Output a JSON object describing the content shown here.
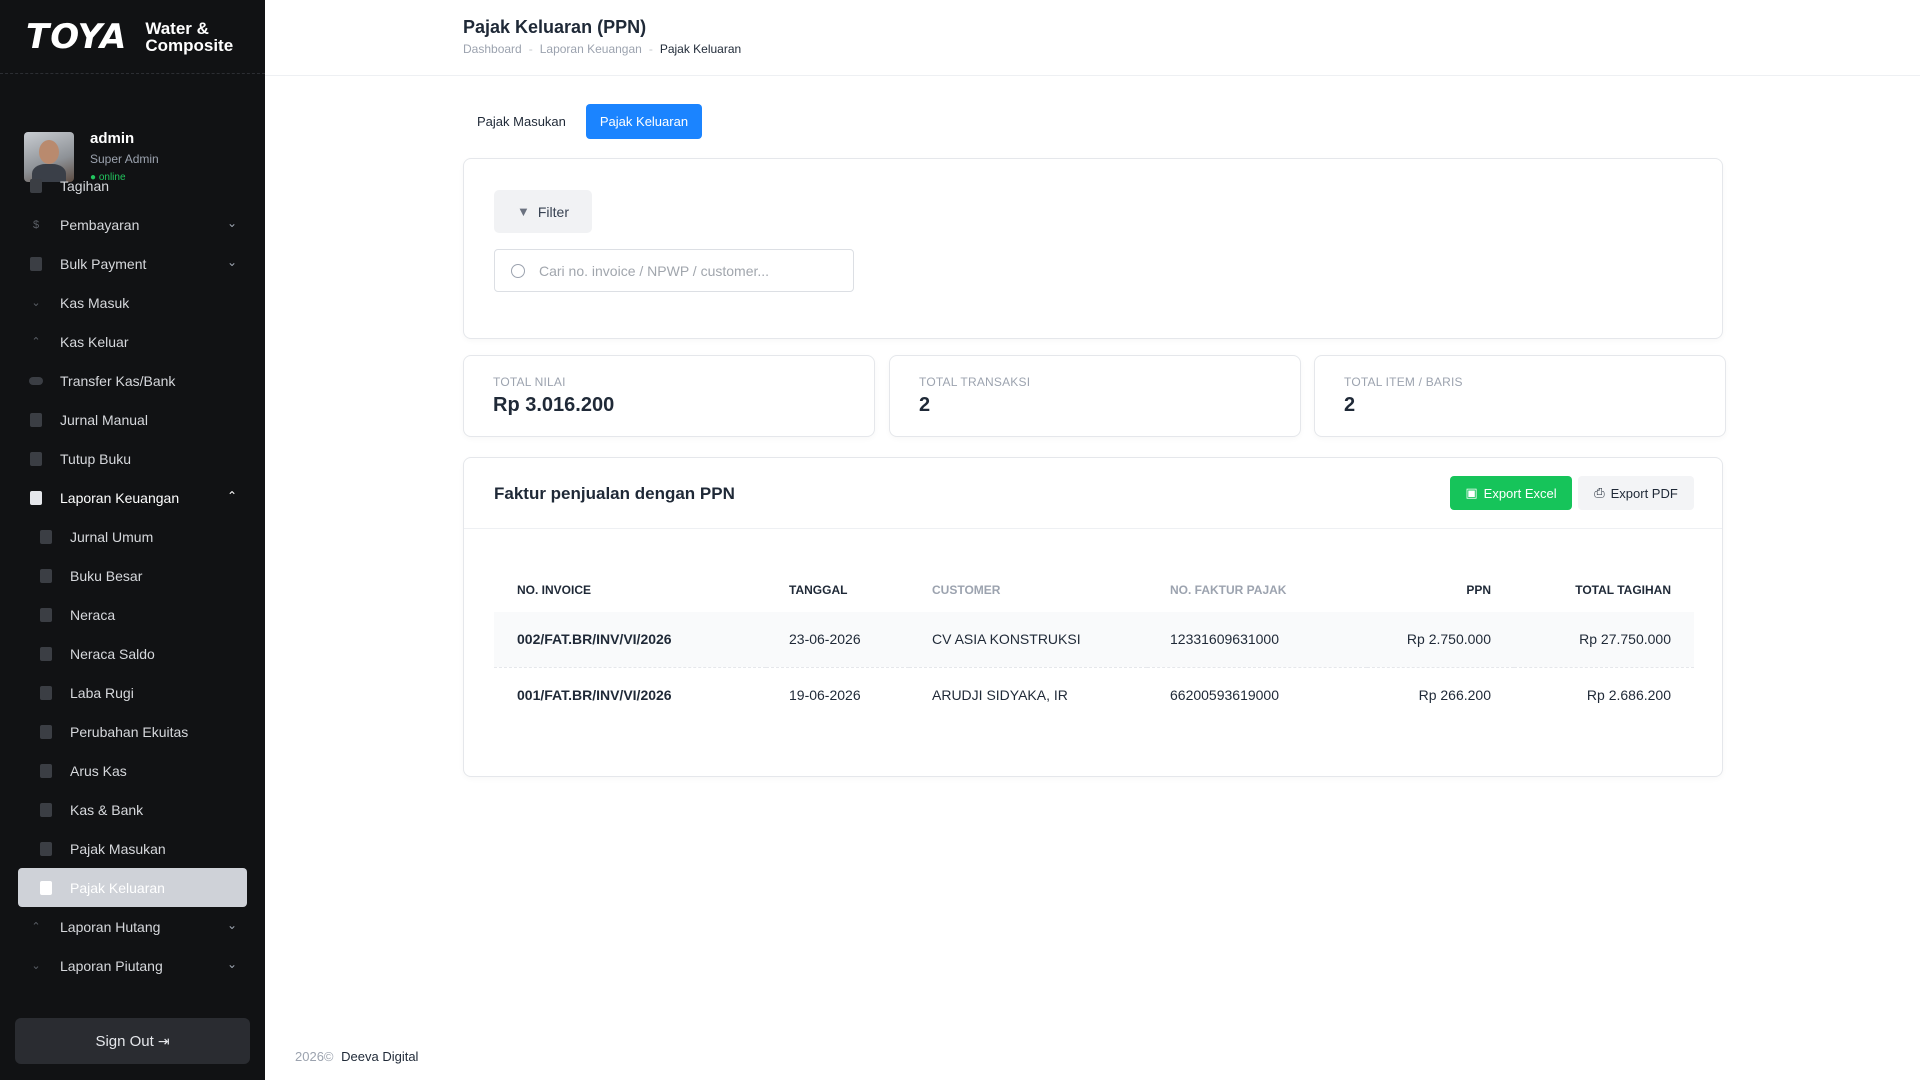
{
  "brand": {
    "logo": "TOYA",
    "sub_line1": "Water &",
    "sub_line2": "Composite"
  },
  "user": {
    "name": "admin",
    "role": "Super Admin",
    "status": "● online"
  },
  "sidebar": {
    "items": [
      {
        "label": "Tagihan"
      },
      {
        "label": "Pembayaran"
      },
      {
        "label": "Bulk Payment"
      },
      {
        "label": "Kas Masuk"
      },
      {
        "label": "Kas Keluar"
      },
      {
        "label": "Transfer Kas/Bank"
      },
      {
        "label": "Jurnal Manual"
      },
      {
        "label": "Tutup Buku"
      },
      {
        "label": "Laporan Keuangan"
      },
      {
        "label": "Jurnal Umum"
      },
      {
        "label": "Buku Besar"
      },
      {
        "label": "Neraca"
      },
      {
        "label": "Neraca Saldo"
      },
      {
        "label": "Laba Rugi"
      },
      {
        "label": "Perubahan Ekuitas"
      },
      {
        "label": "Arus Kas"
      },
      {
        "label": "Kas & Bank"
      },
      {
        "label": "Pajak Masukan"
      },
      {
        "label": "Pajak Keluaran"
      },
      {
        "label": "Laporan Hutang"
      },
      {
        "label": "Laporan Piutang"
      }
    ],
    "signout_label": "Sign Out"
  },
  "header": {
    "title": "Pajak Keluaran (PPN)",
    "breadcrumb": [
      "Dashboard",
      "Laporan Keuangan",
      "Pajak Keluaran"
    ]
  },
  "tabs": [
    {
      "label": "Pajak Masukan",
      "active": false
    },
    {
      "label": "Pajak Keluaran",
      "active": true
    }
  ],
  "filter": {
    "button_label": "Filter",
    "search_placeholder": "Cari no. invoice / NPWP / customer...",
    "search_value": ""
  },
  "stats": [
    {
      "label": "TOTAL NILAI",
      "value": "Rp 3.016.200"
    },
    {
      "label": "TOTAL TRANSAKSI",
      "value": "2"
    },
    {
      "label": "TOTAL ITEM / BARIS",
      "value": "2"
    }
  ],
  "table": {
    "title": "Faktur penjualan dengan PPN",
    "export_excel_label": "Export Excel",
    "export_pdf_label": "Export PDF",
    "columns": [
      "NO. INVOICE",
      "TANGGAL",
      "CUSTOMER",
      "NO. FAKTUR PAJAK",
      "PPN",
      "TOTAL TAGIHAN"
    ],
    "rows": [
      [
        "002/FAT.BR/INV/VI/2026",
        "23-06-2026",
        "CV ASIA KONSTRUKSI",
        "12331609631000",
        "Rp 2.750.000",
        "Rp 27.750.000"
      ],
      [
        "001/FAT.BR/INV/VI/2026",
        "19-06-2026",
        "ARUDJI SIDYAKA, IR",
        "66200593619000",
        "Rp 266.200",
        "Rp 2.686.200"
      ]
    ]
  },
  "footer": {
    "year": "2026©",
    "company": "Deeva Digital"
  },
  "colors": {
    "accent": "#1b84ff",
    "excel": "#16c45a",
    "sidebar_bg": "#111214",
    "online": "#22c55e"
  }
}
